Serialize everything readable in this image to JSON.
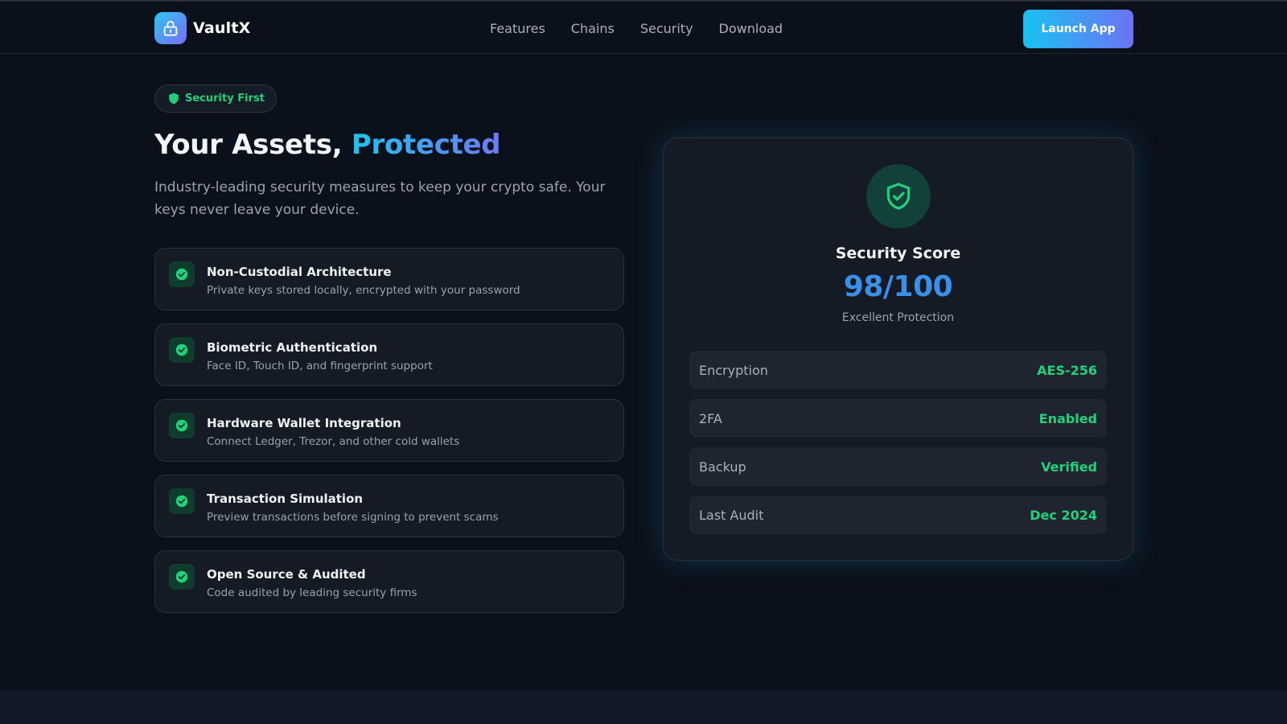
{
  "colors": {
    "background": "#0b111b",
    "accent_cyan": "#1fc3ef",
    "accent_violet": "#6d7bf5",
    "success": "#22d17a",
    "score": "#3a8fe8"
  },
  "header": {
    "brand_name": "VaultX",
    "logo_icon": "lock-icon",
    "nav": [
      {
        "label": "Features"
      },
      {
        "label": "Chains"
      },
      {
        "label": "Security"
      },
      {
        "label": "Download"
      }
    ],
    "cta_label": "Launch App"
  },
  "hero": {
    "badge_icon": "shield-icon",
    "badge_label": "Security First",
    "title_prefix": "Your Assets, ",
    "title_highlight": "Protected",
    "subtitle": "Industry-leading security measures to keep your crypto safe. Your keys never leave your device."
  },
  "features": [
    {
      "title": "Non-Custodial Architecture",
      "description": "Private keys stored locally, encrypted with your password",
      "icon": "check-circle-icon"
    },
    {
      "title": "Biometric Authentication",
      "description": "Face ID, Touch ID, and fingerprint support",
      "icon": "check-circle-icon"
    },
    {
      "title": "Hardware Wallet Integration",
      "description": "Connect Ledger, Trezor, and other cold wallets",
      "icon": "check-circle-icon"
    },
    {
      "title": "Transaction Simulation",
      "description": "Preview transactions before signing to prevent scams",
      "icon": "check-circle-icon"
    },
    {
      "title": "Open Source & Audited",
      "description": "Code audited by leading security firms",
      "icon": "check-circle-icon"
    }
  ],
  "score_card": {
    "icon": "shield-check-icon",
    "title": "Security Score",
    "score": "98/100",
    "caption": "Excellent Protection",
    "metrics": [
      {
        "label": "Encryption",
        "value": "AES-256"
      },
      {
        "label": "2FA",
        "value": "Enabled"
      },
      {
        "label": "Backup",
        "value": "Verified"
      },
      {
        "label": "Last Audit",
        "value": "Dec 2024"
      }
    ]
  }
}
